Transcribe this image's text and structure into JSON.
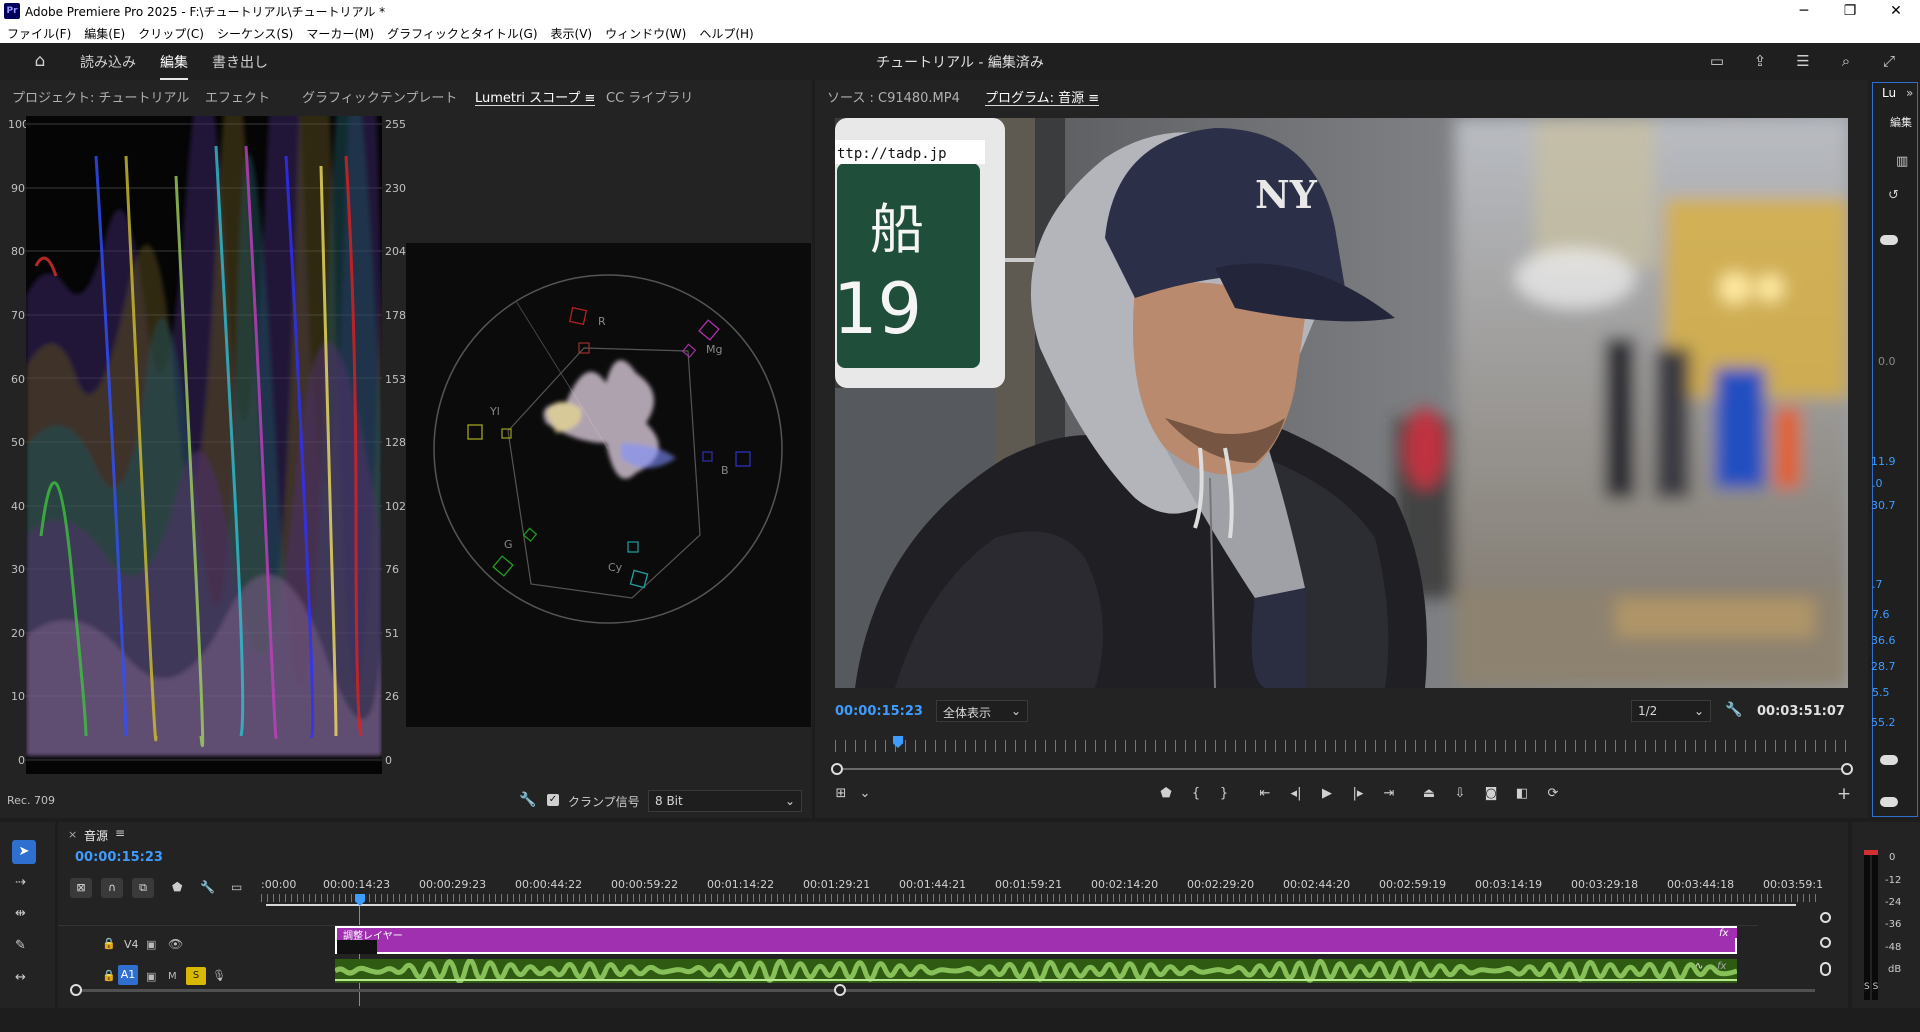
{
  "window": {
    "title": "Adobe Premiere Pro 2025 - F:\\チュートリアル\\チュートリアル *",
    "app_badge": "Pr"
  },
  "menu": [
    "ファイル(F)",
    "編集(E)",
    "クリップ(C)",
    "シーケンス(S)",
    "マーカー(M)",
    "グラフィックとタイトル(G)",
    "表示(V)",
    "ウィンドウ(W)",
    "ヘルプ(H)"
  ],
  "header": {
    "tabs": [
      "読み込み",
      "編集",
      "書き出し"
    ],
    "active_tab": "編集",
    "document_title": "チュートリアル - 編集済み"
  },
  "left_panel": {
    "tabs": [
      "プロジェクト: チュートリアル",
      "エフェクト",
      "グラフィックテンプレート",
      "Lumetri スコープ ≡",
      "CC ライブラリ"
    ],
    "active_tab": "Lumetri スコープ ≡",
    "waveform_left_scale": [
      "100",
      "90",
      "80",
      "70",
      "60",
      "50",
      "40",
      "30",
      "20",
      "10",
      "0"
    ],
    "waveform_right_scale": [
      "255",
      "230",
      "204",
      "178",
      "153",
      "128",
      "102",
      "76",
      "51",
      "26",
      "0"
    ],
    "vectorscope_labels": {
      "r": "R",
      "mg": "Mg",
      "b": "B",
      "cy": "Cy",
      "g": "G",
      "yl": "Yl"
    },
    "color_space": "Rec. 709",
    "clamp_signal_label": "クランプ信号",
    "clamp_checked": true,
    "bit_depth": "8 Bit"
  },
  "program_panel": {
    "tabs": [
      "ソース : C91480.MP4",
      "プログラム: 音源 ≡"
    ],
    "active_tab": "プログラム: 音源 ≡",
    "sign_url": "ttp://tadp.jp",
    "sign_kanji": "船",
    "sign_number": "19",
    "cap_logo": "NY",
    "current_timecode": "00:00:15:23",
    "fit_option": "全体表示",
    "resolution": "1/2",
    "duration": "00:03:51:07",
    "playhead_fraction": 0.068
  },
  "right_panel": {
    "tab_label": "Lu",
    "sub_label": "編集",
    "values": [
      "0.0",
      "11.9",
      ".0",
      "30.7",
      ".7",
      "7.6",
      "36.6",
      "28.7",
      "5.5",
      "55.2"
    ]
  },
  "timeline": {
    "sequence_name": "音源",
    "current_timecode": "00:00:15:23",
    "ruler_labels": [
      ":00:00",
      "00:00:14:23",
      "00:00:29:23",
      "00:00:44:22",
      "00:00:59:22",
      "00:01:14:22",
      "00:01:29:21",
      "00:01:44:21",
      "00:01:59:21",
      "00:02:14:20",
      "00:02:29:20",
      "00:02:44:20",
      "00:02:59:19",
      "00:03:14:19",
      "00:03:29:18",
      "00:03:44:18",
      "00:03:59:1"
    ],
    "tracks": [
      {
        "name": "V4",
        "clip_label": "調整レイヤー",
        "clip_fx": "fx"
      },
      {
        "name": "A1",
        "mute_label": "M",
        "solo_label": "S",
        "clip_fx": "fx"
      }
    ],
    "meter_scale": [
      "0",
      "-12",
      "-24",
      "-36",
      "-48",
      "dB"
    ],
    "meter_bottom": "S S"
  },
  "colors": {
    "accent_blue": "#3e9cff",
    "adjustment_clip": "#a030b0",
    "audio_clip": "#2e5a12",
    "solo_yellow": "#d8b800"
  }
}
